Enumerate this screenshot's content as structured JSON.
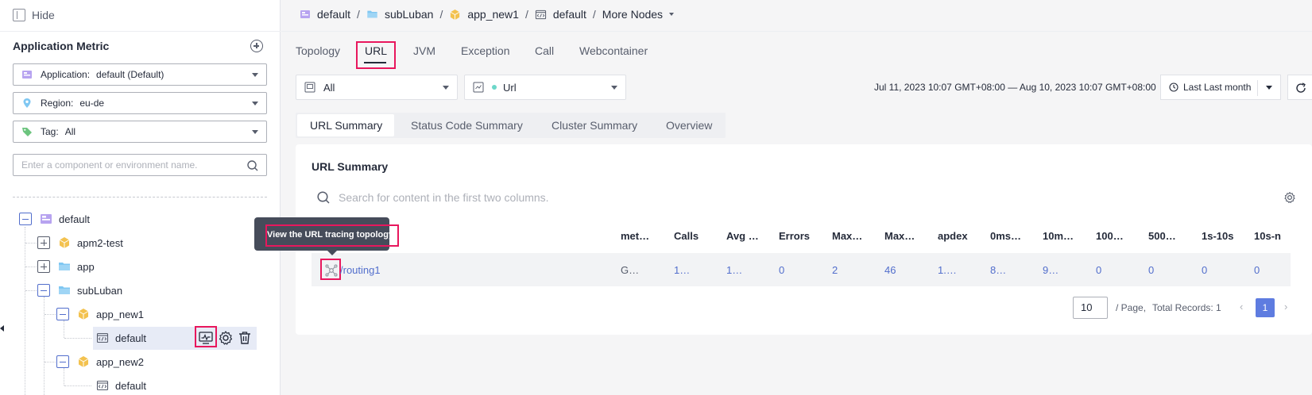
{
  "sidebar": {
    "hide_label": "Hide",
    "section_title": "Application Metric",
    "application": {
      "label": "Application:",
      "value": "default (Default)"
    },
    "region": {
      "label": "Region:",
      "value": "eu-de"
    },
    "tag": {
      "label": "Tag:",
      "value": "All"
    },
    "search_placeholder": "Enter a component or environment name.",
    "tree": {
      "root": "default",
      "n1": "apm2-test",
      "n2": "app",
      "n3": "subLuban",
      "n4": "app_new1",
      "n5": "default",
      "n6": "app_new2",
      "n7": "default"
    }
  },
  "breadcrumb": {
    "b1": "default",
    "b2": "subLuban",
    "b3": "app_new1",
    "b4": "default",
    "b5": "More Nodes",
    "sep": "/"
  },
  "tabs": {
    "t1": "Topology",
    "t2": "URL",
    "t3": "JVM",
    "t4": "Exception",
    "t5": "Call",
    "t6": "Webcontainer"
  },
  "filters": {
    "first": "All",
    "second": "Url"
  },
  "time": {
    "range": "Jul 11, 2023 10:07 GMT+08:00 — Aug 10, 2023 10:07 GMT+08:00",
    "preset": "Last Last month"
  },
  "subtabs": {
    "s1": "URL Summary",
    "s2": "Status Code Summary",
    "s3": "Cluster Summary",
    "s4": "Overview"
  },
  "card": {
    "title": "URL Summary",
    "search_placeholder": "Search for content in the first two columns."
  },
  "table": {
    "headers": {
      "h_method": "met…",
      "h_calls": "Calls",
      "h_avg": "Avg …",
      "h_errors": "Errors",
      "h_max1": "Max…",
      "h_max2": "Max…",
      "h_apdex": "apdex",
      "h_c1": "0ms…",
      "h_c2": "10m…",
      "h_c3": "100…",
      "h_c4": "500…",
      "h_c5": "1s-10s",
      "h_c6": "10s-n"
    },
    "row": {
      "url": "/routing1",
      "method": "G…",
      "calls": "1…",
      "avg": "1…",
      "errors": "0",
      "max1": "2",
      "max2": "46",
      "apdex": "1.…",
      "c1": "8…",
      "c2": "9…",
      "c3": "0",
      "c4": "0",
      "c5": "0",
      "c6": "0"
    }
  },
  "pagination": {
    "page_size": "10",
    "per_page": "/ Page,",
    "total": "Total Records: 1",
    "current": "1",
    "prev": "‹",
    "next": "›"
  },
  "tooltip": {
    "text": "View the URL tracing topology."
  },
  "colors": {
    "accent": "#5e7ce0",
    "highlight": "#e8175d",
    "link": "#526ecc"
  }
}
